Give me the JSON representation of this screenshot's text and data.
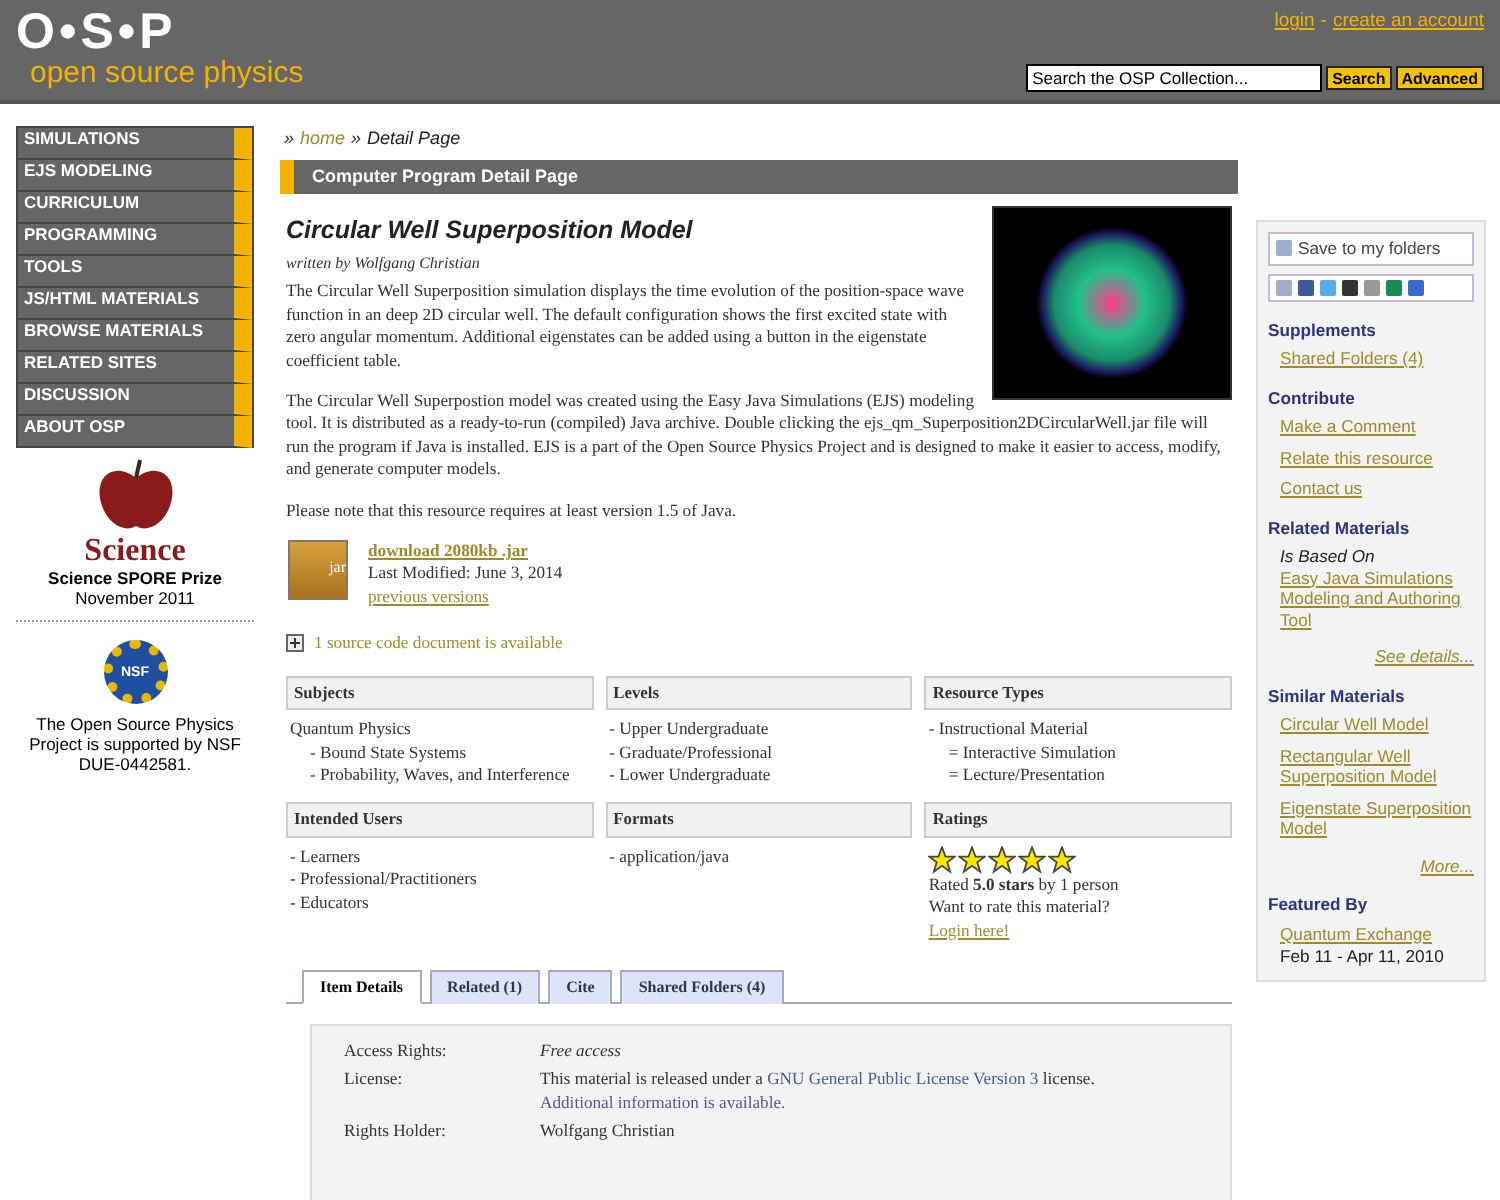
{
  "header": {
    "logo": "O•S•P",
    "tagline": "open source physics",
    "login": "login",
    "separator": "-",
    "create_account": "create an account",
    "search": {
      "placeholder": "Search the OSP Collection..."
    },
    "search_button": "Search",
    "advanced_button": "Advanced"
  },
  "nav": {
    "items": [
      "SIMULATIONS",
      "EJS MODELING",
      "CURRICULUM",
      "PROGRAMMING",
      "TOOLS",
      "JS/HTML MATERIALS",
      "BROWSE MATERIALS",
      "RELATED SITES",
      "DISCUSSION",
      "ABOUT OSP"
    ]
  },
  "awards": [
    {
      "kind": "science",
      "logo_text": "Science",
      "title": "Science SPORE Prize",
      "date": "November 2011"
    },
    {
      "kind": "nsf",
      "logo_text": "NSF",
      "text": "The Open Source Physics Project is supported by NSF DUE-0442581."
    }
  ],
  "breadcrumb": {
    "separator": "»",
    "home": "home",
    "current": "Detail Page"
  },
  "section_title": "Computer Program Detail Page",
  "resource": {
    "title": "Circular Well Superposition Model",
    "author": "written by Wolfgang Christian",
    "paragraphs": [
      "The Circular Well Superposition simulation displays the time evolution of the position-space wave function in an deep 2D circular well.  The default configuration shows the first excited state with zero angular momentum.  Additional eigenstates can be added using a button in the eigenstate coefficient table.",
      "The Circular Well Superpostion model was created using the Easy Java Simulations (EJS) modeling tool.  It is distributed as a ready-to-run (compiled) Java archive.  Double clicking the ejs_qm_Superposition2DCircularWell.jar file will run the program if Java is installed.  EJS is a part of the Open Source Physics Project and is designed to make it easier to access, modify, and generate computer models.",
      "Please note that this resource requires at least version 1.5 of Java."
    ],
    "download": {
      "file_type": "jar",
      "link": "download 2080kb .jar",
      "modified": "Last Modified: June 3, 2014",
      "previous": "previous versions"
    },
    "source_docs": "1 source code document is available"
  },
  "facets": [
    {
      "kind": "list",
      "heading": "Subjects",
      "items": [
        {
          "text": "Quantum Physics",
          "children": [
            {
              "text": "- Bound State Systems"
            },
            {
              "text": "- Probability, Waves, and Interference"
            }
          ]
        }
      ]
    },
    {
      "kind": "list",
      "heading": "Levels",
      "items": [
        {
          "text": "- Upper Undergraduate"
        },
        {
          "text": "- Graduate/Professional"
        },
        {
          "text": "- Lower Undergraduate"
        }
      ]
    },
    {
      "kind": "list",
      "heading": "Resource Types",
      "items": [
        {
          "text": "- Instructional Material",
          "children": [
            {
              "text": "= Interactive Simulation"
            },
            {
              "text": "= Lecture/Presentation"
            }
          ]
        }
      ]
    },
    {
      "kind": "list",
      "heading": "Intended Users",
      "items": [
        {
          "text": "- Learners"
        },
        {
          "text": "- Professional/Practitioners"
        },
        {
          "text": "- Educators"
        }
      ]
    },
    {
      "kind": "list",
      "heading": "Formats",
      "items": [
        {
          "text": "- application/java"
        }
      ]
    },
    {
      "kind": "ratings",
      "heading": "Ratings",
      "stars": 5,
      "rated": "Rated **5.0 stars** by 1 person",
      "prompt": "Want to rate this material?",
      "login": "Login here!"
    }
  ],
  "tabs": [
    {
      "label": "Item Details",
      "selected": true
    },
    {
      "label": "Related (1)",
      "selected": false
    },
    {
      "label": "Cite",
      "selected": false
    },
    {
      "label": "Shared Folders (4)",
      "selected": false
    }
  ],
  "details": [
    {
      "label": "Access Rights:",
      "kind": "emphasis",
      "parts": [
        {
          "text": "Free access",
          "link": false
        }
      ]
    },
    {
      "label": "License:",
      "kind": "plain",
      "parts": [
        {
          "text": "This material is released under a ",
          "link": false
        },
        {
          "text": "GNU General Public License Version 3",
          "link": true
        },
        {
          "text": " license. ",
          "link": false
        },
        {
          "text": "Additional information is available.",
          "link": true
        }
      ]
    },
    {
      "label": "Rights Holder:",
      "kind": "plain",
      "parts": [
        {
          "text": "Wolfgang Christian",
          "link": false
        }
      ]
    }
  ],
  "sidebar": {
    "save": "Save to my folders",
    "sections": [
      {
        "heading": "Supplements",
        "links": [
          "Shared Folders (4)"
        ]
      },
      {
        "heading": "Contribute",
        "links": [
          "Make a Comment",
          "Relate this resource",
          "Contact us"
        ]
      },
      {
        "heading": "Related Materials",
        "note": "Is Based On",
        "links": [
          "Easy Java Simulations Modeling and Authoring Tool"
        ],
        "more": "See details..."
      },
      {
        "heading": "Similar Materials",
        "links": [
          "Circular Well Model",
          "Rectangular Well Superposition Model",
          "Eigenstate Superposition Model"
        ],
        "more": "More..."
      },
      {
        "heading": "Featured By",
        "links": [
          "Quantum Exchange"
        ],
        "after": "Feb 11 - Apr 11, 2010"
      }
    ]
  }
}
